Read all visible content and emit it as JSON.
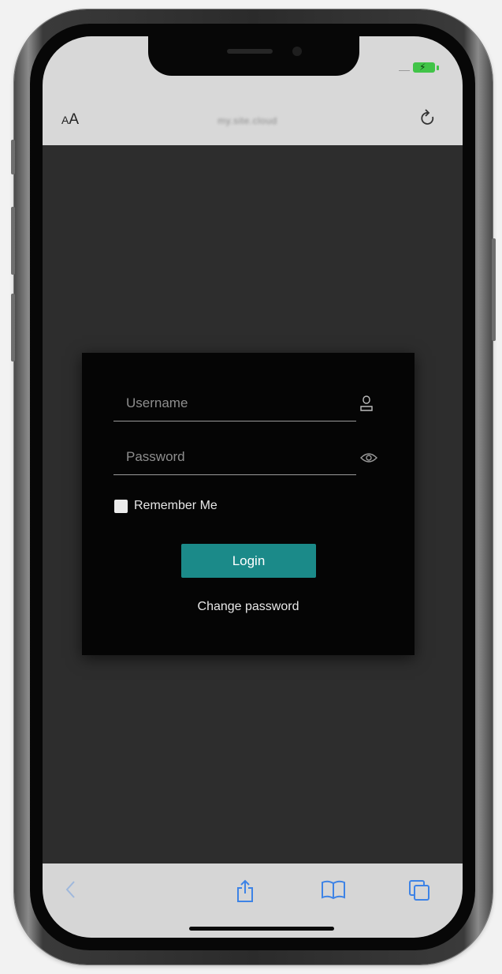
{
  "status_bar": {
    "battery_icon": "battery-charging-icon",
    "battery_color": "#41c448"
  },
  "browser": {
    "text_size_button": {
      "small": "A",
      "big": "A"
    },
    "url": "my.site.cloud",
    "reload_icon": "reload-icon"
  },
  "login": {
    "username_placeholder": "Username",
    "username_icon": "user-icon",
    "password_placeholder": "Password",
    "password_icon": "eye-icon",
    "remember_label": "Remember Me",
    "login_label": "Login",
    "change_password_label": "Change password",
    "accent_color": "#1b8a89"
  },
  "toolbar": {
    "items": [
      "back-icon",
      "share-icon",
      "bookmarks-icon",
      "tabs-icon"
    ],
    "icon_color": "#3d83e6"
  }
}
